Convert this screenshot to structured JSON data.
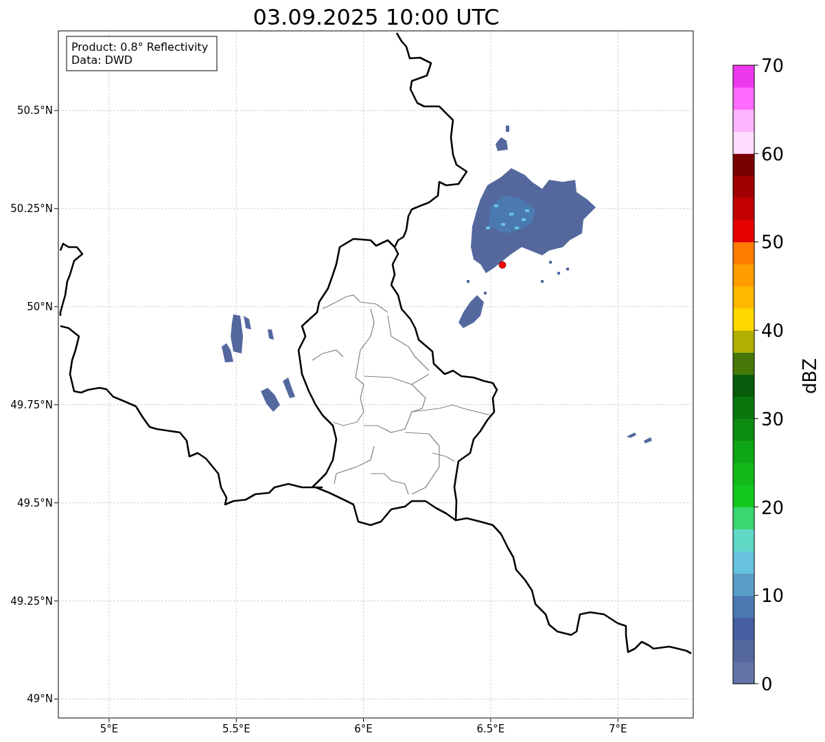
{
  "title": "03.09.2025 10:00 UTC",
  "map": {
    "legend": [
      "Product: 0.8° Reflectivity",
      "Data: DWD"
    ],
    "y_ticks": [
      "50.5°N",
      "50.25°N",
      "50°N",
      "49.75°N",
      "49.5°N",
      "49.25°N",
      "49°N"
    ],
    "x_ticks": [
      "5°E",
      "5.5°E",
      "6°E",
      "6.5°E",
      "7°E"
    ]
  },
  "colorbar": {
    "label": "dBZ",
    "ticks": [
      "70",
      "60",
      "50",
      "40",
      "30",
      "20",
      "10",
      "0"
    ],
    "bins": [
      {
        "color": "#6474a6"
      },
      {
        "color": "#54689e"
      },
      {
        "color": "#445ea0"
      },
      {
        "color": "#4b7ab2"
      },
      {
        "color": "#5a9ec8"
      },
      {
        "color": "#66c2de"
      },
      {
        "color": "#60d8c6"
      },
      {
        "color": "#3cd670"
      },
      {
        "color": "#12c81c"
      },
      {
        "color": "#10b818"
      },
      {
        "color": "#0ea614"
      },
      {
        "color": "#0c8c12"
      },
      {
        "color": "#0a760e"
      },
      {
        "color": "#065c0a"
      },
      {
        "color": "#467808"
      },
      {
        "color": "#b0b000"
      },
      {
        "color": "#ffd800"
      },
      {
        "color": "#ffb800"
      },
      {
        "color": "#ff9c00"
      },
      {
        "color": "#ff7c00"
      },
      {
        "color": "#e60000"
      },
      {
        "color": "#c40000"
      },
      {
        "color": "#a00000"
      },
      {
        "color": "#780000"
      },
      {
        "color": "#ffdcff"
      },
      {
        "color": "#ffb4ff"
      },
      {
        "color": "#ff6cff"
      },
      {
        "color": "#ee38ee"
      }
    ]
  }
}
